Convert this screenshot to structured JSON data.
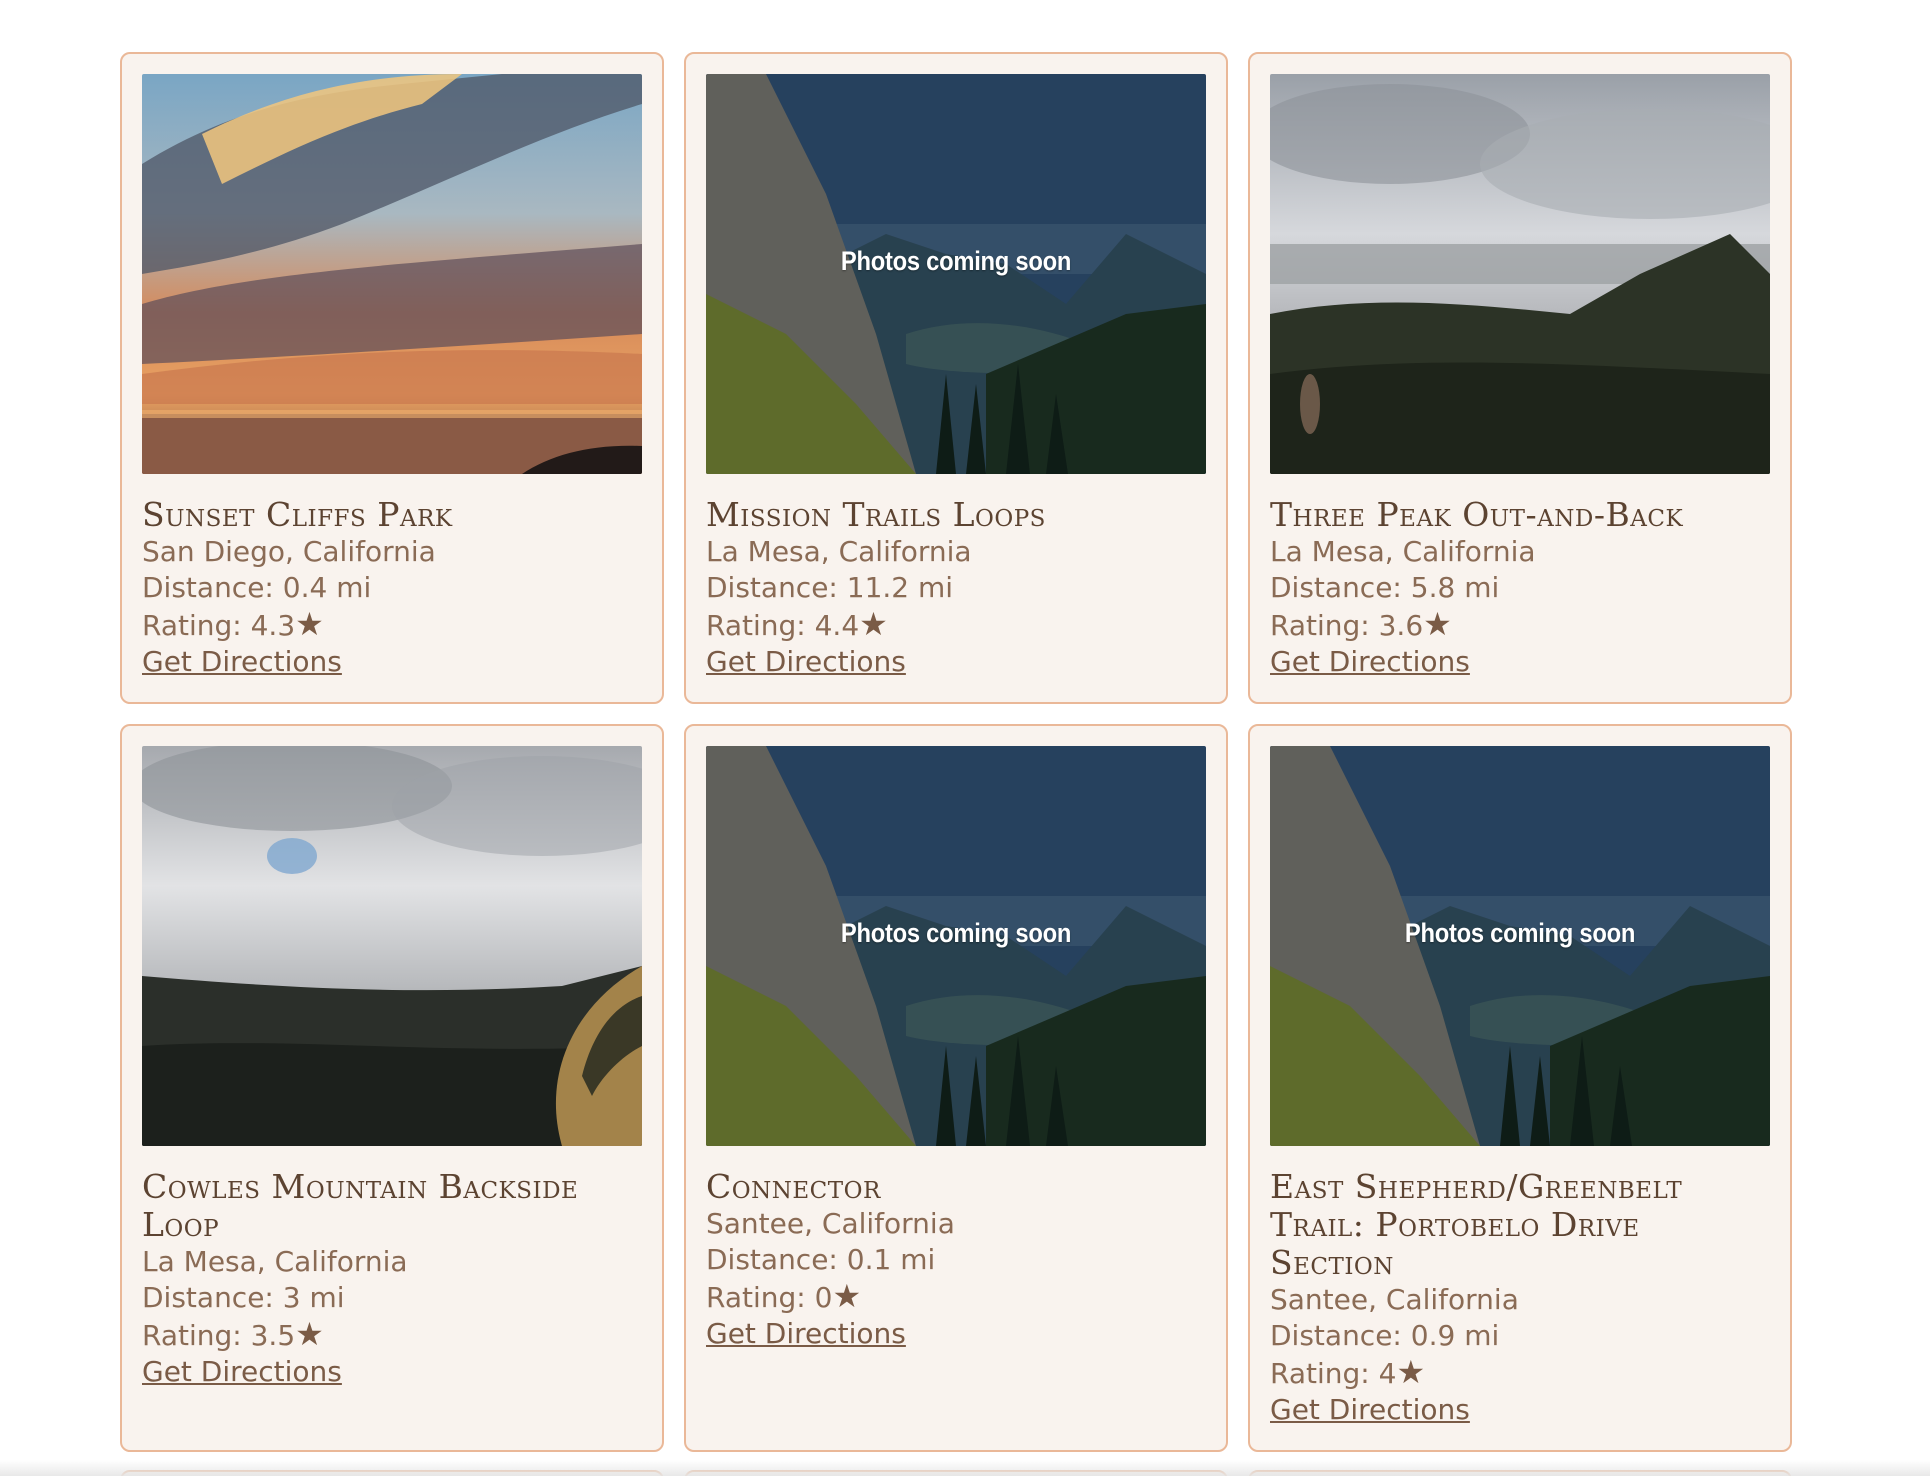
{
  "trails": [
    {
      "name": "Sunset Cliffs Park",
      "location": "San Diego, California",
      "distance": "Distance: 0.4 mi",
      "rating": "Rating: 4.3",
      "rating_value": 4.3,
      "directions_label": "Get Directions",
      "photo": "sunset",
      "photo_caption": ""
    },
    {
      "name": "Mission Trails Loops",
      "location": "La Mesa, California",
      "distance": "Distance: 11.2 mi",
      "rating": "Rating: 4.4",
      "rating_value": 4.4,
      "directions_label": "Get Directions",
      "photo": "placeholder",
      "photo_caption": "Photos coming soon"
    },
    {
      "name": "Three Peak Out-and-Back",
      "location": "La Mesa, California",
      "distance": "Distance: 5.8 mi",
      "rating": "Rating: 3.6",
      "rating_value": 3.6,
      "directions_label": "Get Directions",
      "photo": "cloudy-peak",
      "photo_caption": ""
    },
    {
      "name": "Cowles Mountain Backside Loop",
      "location": "La Mesa, California",
      "distance": "Distance: 3 mi",
      "rating": "Rating: 3.5",
      "rating_value": 3.5,
      "directions_label": "Get Directions",
      "photo": "cloudy-valley",
      "photo_caption": ""
    },
    {
      "name": "Connector",
      "location": "Santee, California",
      "distance": "Distance: 0.1 mi",
      "rating": "Rating: 0",
      "rating_value": 0,
      "directions_label": "Get Directions",
      "photo": "placeholder",
      "photo_caption": "Photos coming soon"
    },
    {
      "name": "East Shepherd/Greenbelt Trail: Portobelo Drive Section",
      "location": "Santee, California",
      "distance": "Distance: 0.9 mi",
      "rating": "Rating: 4",
      "rating_value": 4,
      "directions_label": "Get Directions",
      "photo": "placeholder",
      "photo_caption": "Photos coming soon"
    }
  ],
  "star_glyph": "★",
  "colors": {
    "card_bg": "#f9f3ee",
    "card_border": "#eab898",
    "text_brown": "#7a5b46",
    "title_brown": "#5c4331"
  }
}
